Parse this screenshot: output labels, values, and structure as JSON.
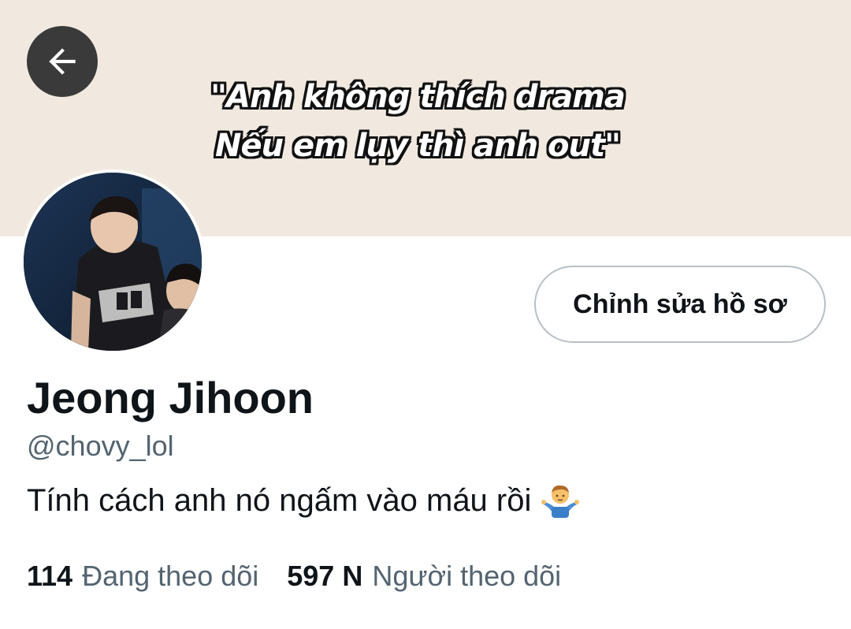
{
  "header": {
    "back_icon": "arrow-left-icon",
    "banner_color": "#f1e9df",
    "banner_quote_line1": "\"Anh không thích drama",
    "banner_quote_line2": "Nếu em lụy thì anh out\""
  },
  "profile": {
    "display_name": "Jeong Jihoon",
    "handle": "@chovy_lol",
    "bio": "Tính cách anh nó ngấm vào máu rồi",
    "bio_emoji": "person-shrugging-emoji",
    "edit_button_label": "Chỉnh sửa hồ sơ"
  },
  "stats": {
    "following_count": "114",
    "following_label": "Đang theo dõi",
    "followers_count": "597 N",
    "followers_label": "Người theo dõi"
  },
  "colors": {
    "text_primary": "#0f1419",
    "text_secondary": "#536471",
    "button_border": "#b7c0c7"
  }
}
